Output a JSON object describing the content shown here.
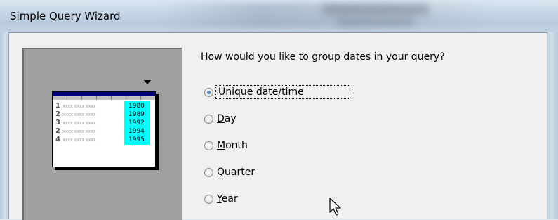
{
  "window": {
    "title": "Simple Query Wizard"
  },
  "question": "How would you like to group dates in your query?",
  "options": [
    {
      "label": "Unique date/time",
      "mnemonic": "U",
      "rest": "nique date/time",
      "selected": true
    },
    {
      "label": "Day",
      "mnemonic": "D",
      "rest": "ay",
      "selected": false
    },
    {
      "label": "Month",
      "mnemonic": "M",
      "rest": "onth",
      "selected": false
    },
    {
      "label": "Quarter",
      "mnemonic": "Q",
      "rest": "uarter",
      "selected": false
    },
    {
      "label": "Year",
      "mnemonic": "Y",
      "rest": "ear",
      "selected": false
    }
  ],
  "illustration": {
    "rows": [
      {
        "num": "1",
        "filler": "xxxx xxxx xxxx",
        "year": "1980"
      },
      {
        "num": "2",
        "filler": "xxxx xxxx xxxx",
        "year": "1989"
      },
      {
        "num": "3",
        "filler": "xxxx xxxx xxxx",
        "year": "1992"
      },
      {
        "num": "2",
        "filler": "xxxx xxxx xxxx",
        "year": "1994"
      },
      {
        "num": "4",
        "filler": "xxxx xxxx xxxx",
        "year": "1995"
      }
    ],
    "highlight_color": "#00ffff",
    "header_color": "#000080"
  },
  "icons": {
    "cursor": "mouse-pointer-icon",
    "column-marker": "down-arrow-icon"
  }
}
